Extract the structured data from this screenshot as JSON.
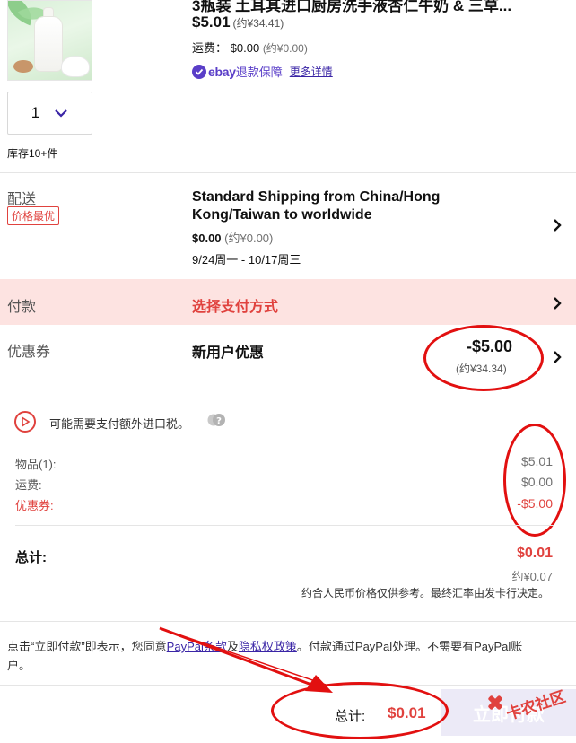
{
  "product": {
    "title": "3瓶装 土耳其进口厨房洗手液杏仁牛奶 & 三草...",
    "price": "$5.01",
    "price_cny": "(约¥34.41)",
    "shipping_fee_label": "运费：",
    "shipping_fee_value": "$0.00",
    "shipping_fee_cny": "(约¥0.00)",
    "guarantee_brand": "ebay",
    "guarantee_text": "退款保障",
    "more_details": "更多详情",
    "quantity": "1",
    "stock": "库存10+件"
  },
  "shipping": {
    "label": "配送",
    "badge": "价格最优",
    "method": "Standard Shipping from China/Hong Kong/Taiwan to worldwide",
    "cost": "$0.00",
    "cost_cny": "(约¥0.00)",
    "dates": "9/24周一 - 10/17周三"
  },
  "payment": {
    "label": "付款",
    "action": "选择支付方式"
  },
  "coupon": {
    "label": "优惠券",
    "name": "新用户优惠",
    "amount": "-$5.00",
    "amount_cny": "(约¥34.34)"
  },
  "summary": {
    "tax_note": "可能需要支付额外进口税。",
    "items_label": "物品(1):",
    "items_value": "$5.01",
    "shipping_label": "运费:",
    "shipping_value": "$0.00",
    "coupon_label": "优惠券:",
    "coupon_value": "-$5.00",
    "total_label": "总计:",
    "total_value": "$0.01",
    "total_cny": "约¥0.07",
    "rate_note": "约合人民币价格仅供参考。最终汇率由发卡行决定。"
  },
  "terms": {
    "prefix": "点击“立即付款”即表示，您同意",
    "paypal_terms": "PayPal条款",
    "and": "及",
    "privacy": "隐私权政策",
    "suffix": "。付款通过PayPal处理。不需要有PayPal账户。"
  },
  "bottom_bar": {
    "total_label": "总计:",
    "total_value": "$0.01",
    "pay_button": "立即付款"
  },
  "watermark": "卡农社区",
  "colors": {
    "accent_red": "#e0423e",
    "ebay_purple": "#5a3ec8",
    "payment_row_bg": "#fde3e1",
    "annotation_red": "#e21010"
  }
}
